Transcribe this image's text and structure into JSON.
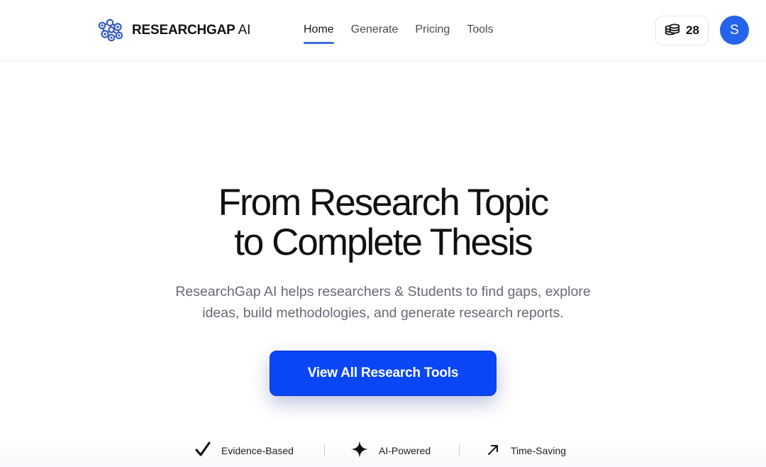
{
  "header": {
    "brand_bold": "RESEARCHGAP",
    "brand_light": "AI",
    "logo_icon": "molecule-network-logo",
    "nav": [
      {
        "label": "Home",
        "active": true
      },
      {
        "label": "Generate",
        "active": false
      },
      {
        "label": "Pricing",
        "active": false
      },
      {
        "label": "Tools",
        "active": false
      }
    ],
    "credits": {
      "icon": "coin-stack-icon",
      "count": "28"
    },
    "avatar_initial": "S"
  },
  "hero": {
    "title_line1": "From Research Topic",
    "title_line2": "to Complete Thesis",
    "subtitle_line1": "ResearchGap AI helps researchers & Students to find gaps, explore",
    "subtitle_line2": "ideas, build methodologies, and generate research reports.",
    "cta_label": "View All Research Tools"
  },
  "features": [
    {
      "icon": "checkmark-icon",
      "label": "Evidence-Based"
    },
    {
      "icon": "sparkle-icon",
      "label": "AI-Powered"
    },
    {
      "icon": "arrow-up-right-icon",
      "label": "Time-Saving"
    }
  ],
  "colors": {
    "primary": "#0a46f5",
    "avatar": "#2563eb",
    "logo": "#3a5bbf",
    "nav_underline": "#3f6fd8"
  }
}
